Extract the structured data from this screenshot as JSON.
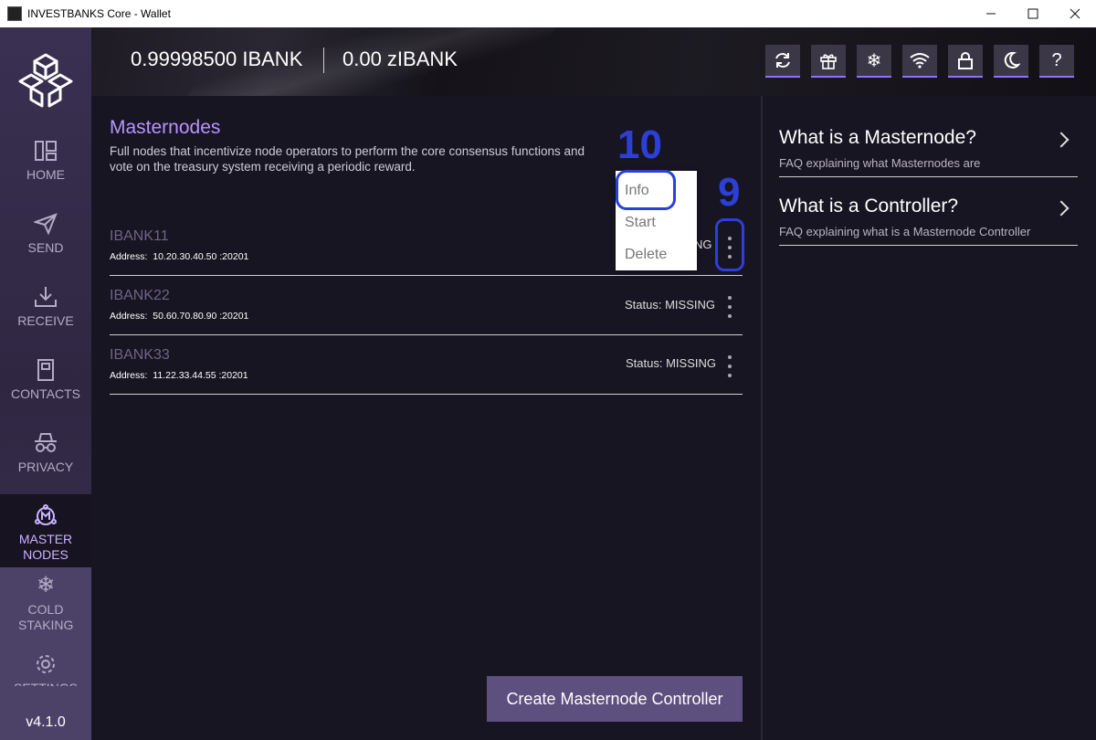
{
  "window": {
    "title": "INVESTBANKS Core - Wallet"
  },
  "sidebar": {
    "items": [
      {
        "label": "HOME",
        "icon": "home-icon"
      },
      {
        "label": "SEND",
        "icon": "send-icon"
      },
      {
        "label": "RECEIVE",
        "icon": "receive-icon"
      },
      {
        "label": "CONTACTS",
        "icon": "contacts-icon"
      },
      {
        "label": "PRIVACY",
        "icon": "privacy-icon"
      },
      {
        "label": "MASTER NODES",
        "icon": "masternodes-icon",
        "active": true
      },
      {
        "label": "COLD STAKING",
        "icon": "snowflake-icon"
      },
      {
        "label": "SETTINGS",
        "icon": "gear-icon"
      }
    ],
    "version": "v4.1.0"
  },
  "topbar": {
    "balance": "0.99998500 IBANK",
    "zbalance": "0.00 zIBANK",
    "buttons": [
      "sync-icon",
      "gift-icon",
      "snowflake-icon",
      "wifi-icon",
      "lock-icon",
      "moon-icon",
      "help-icon"
    ],
    "help_glyph": "?"
  },
  "page": {
    "title": "Masternodes",
    "subtitle": "Full nodes that incentivize node operators to perform the core consensus functions and vote on the treasury system receiving a periodic reward."
  },
  "masternodes": [
    {
      "name": "IBANK11",
      "address_label": "Address:",
      "address": "10.20.30.40.50 :20201",
      "status_fragment": "NG"
    },
    {
      "name": "IBANK22",
      "address_label": "Address:",
      "address": "50.60.70.80.90 :20201",
      "status": "Status: MISSING"
    },
    {
      "name": "IBANK33",
      "address_label": "Address:",
      "address": "11.22.33.44.55 :20201",
      "status": "Status: MISSING"
    }
  ],
  "context_menu": {
    "items": [
      "Info",
      "Start",
      "Delete"
    ]
  },
  "annotations": {
    "callout_menu": "10",
    "callout_dots": "9",
    "color": "#2c3fd6"
  },
  "create_button": {
    "label": "Create Masternode Controller"
  },
  "faq": [
    {
      "title": "What is a Masternode?",
      "desc": "FAQ explaining what Masternodes are"
    },
    {
      "title": "What is a Controller?",
      "desc": "FAQ explaining what is a Masternode Controller"
    }
  ],
  "colors": {
    "accent": "#b794ff",
    "sidebar": "#3a3052",
    "background": "#181522",
    "button": "#5d4f7e"
  }
}
